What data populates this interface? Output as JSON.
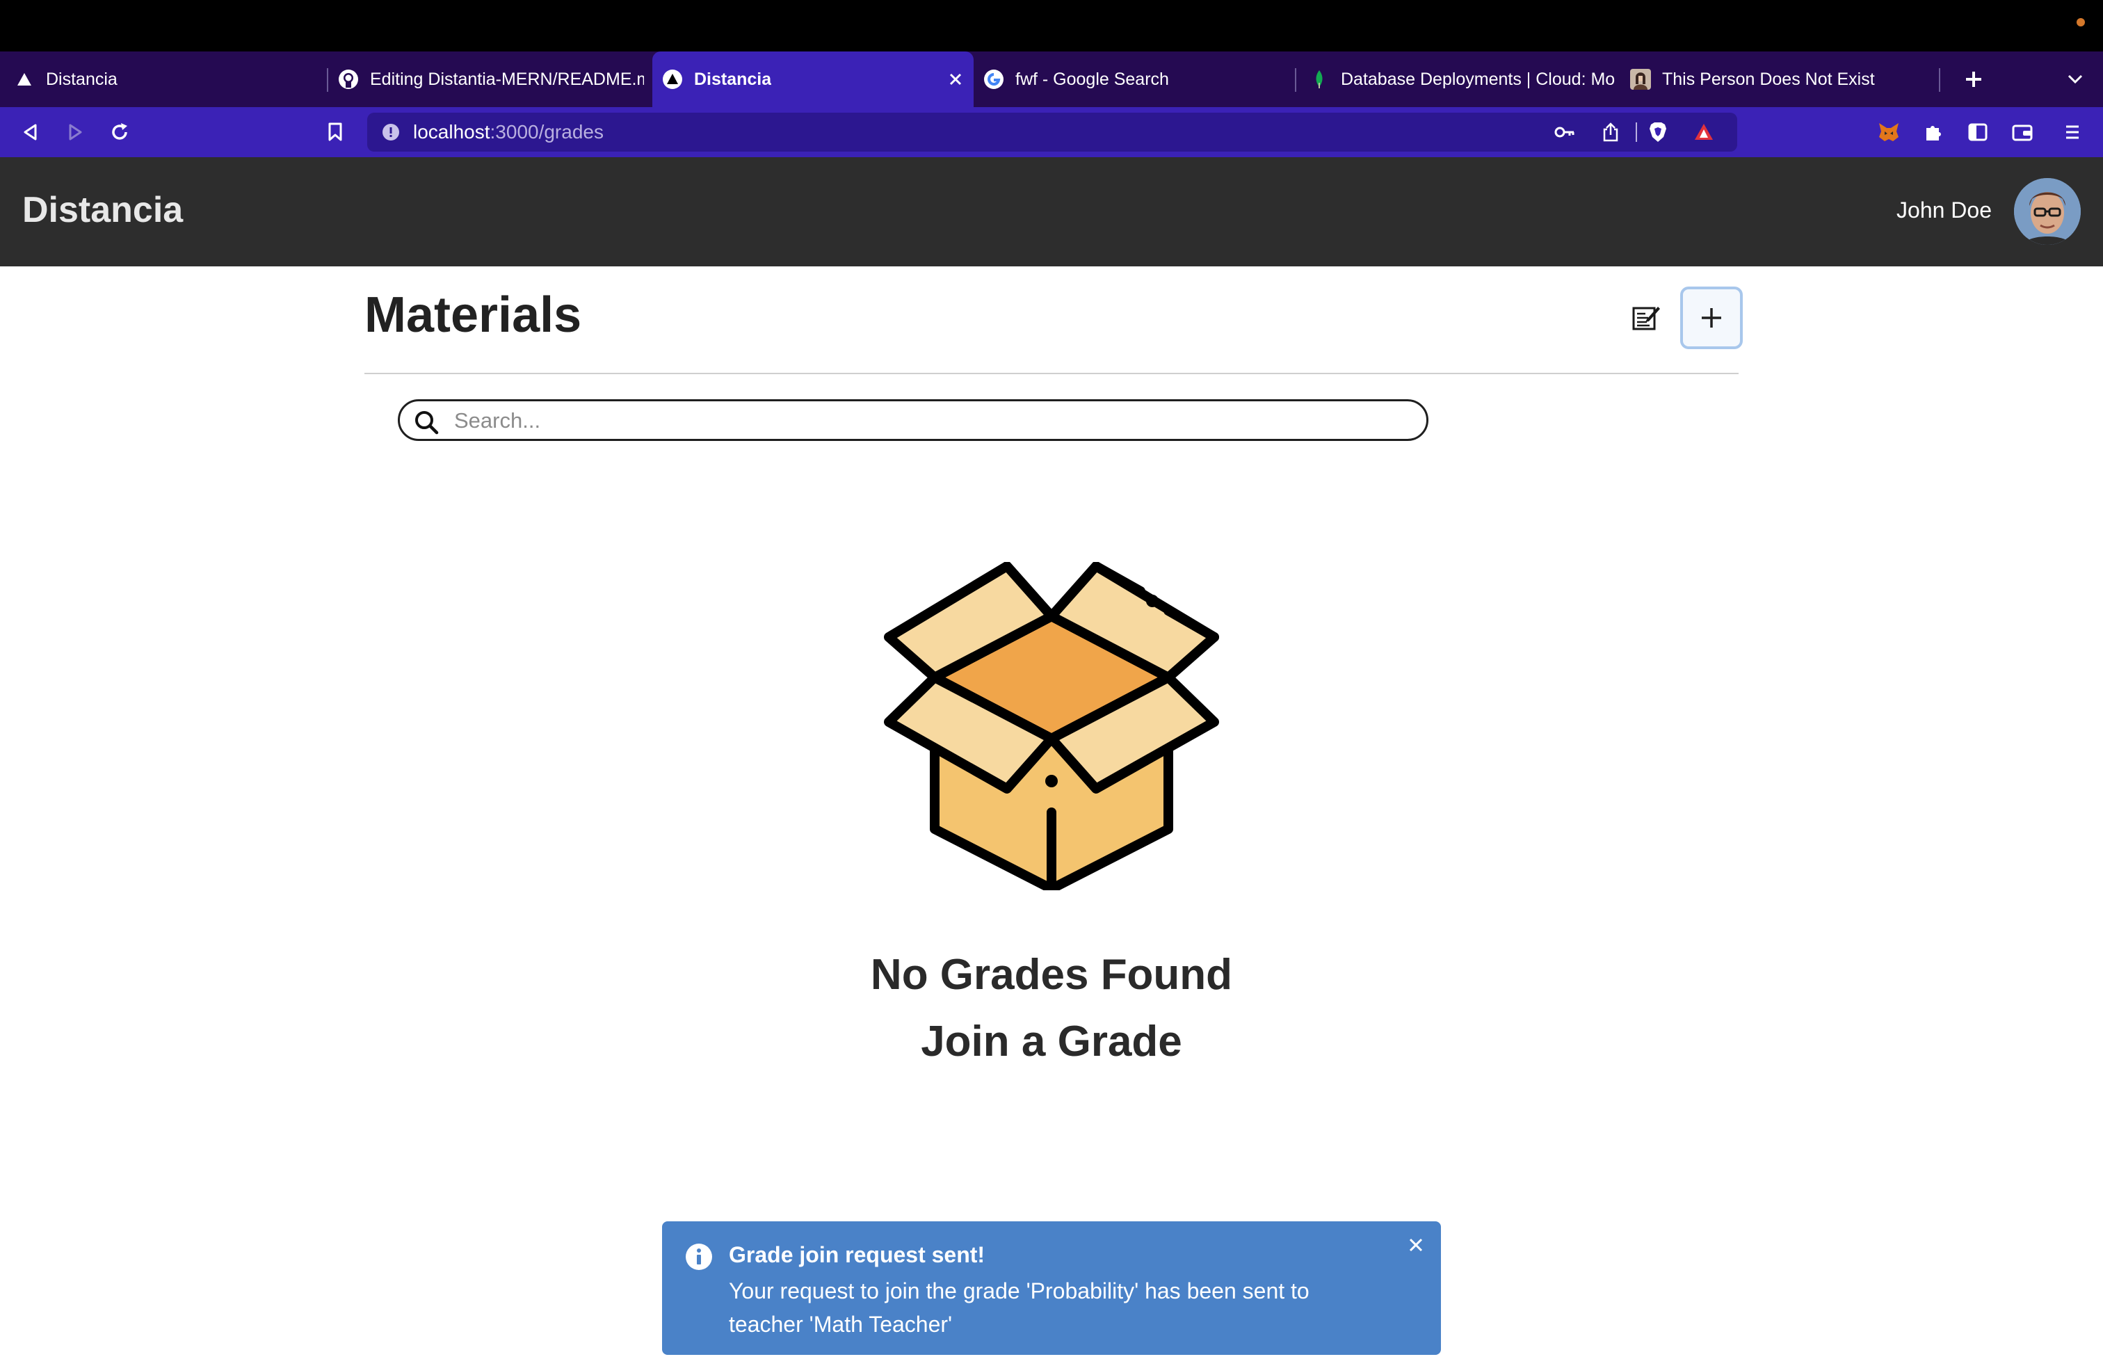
{
  "browser": {
    "tabs": [
      {
        "title": "Distancia",
        "favicon": "triangle-favicon",
        "active": false
      },
      {
        "title": "Editing Distantia-MERN/README.md",
        "favicon": "github-favicon",
        "active": false
      },
      {
        "title": "Distancia",
        "favicon": "triangle-favicon",
        "active": true
      },
      {
        "title": "fwf - Google Search",
        "favicon": "google-favicon",
        "active": false
      },
      {
        "title": "Database Deployments | Cloud: MongoDB",
        "favicon": "mongodb-leaf-favicon",
        "active": false
      },
      {
        "title": "This Person Does Not Exist",
        "favicon": "portrait-favicon",
        "active": false
      }
    ],
    "url_host": "localhost",
    "url_path": ":3000/grades",
    "accent_color": "#3b22b6",
    "tabstrip_color": "#250a52"
  },
  "app": {
    "brand": "Distancia",
    "user_name": "John Doe",
    "header_color": "#2d2d2d"
  },
  "main": {
    "title": "Materials",
    "search_placeholder": "Search...",
    "empty_line1": "No Grades Found",
    "empty_line2": "Join a Grade"
  },
  "toast": {
    "title": "Grade join request sent!",
    "message": "Your request to join the grade 'Probability' has been sent to teacher 'Math Teacher'",
    "color": "#4a82c8"
  }
}
